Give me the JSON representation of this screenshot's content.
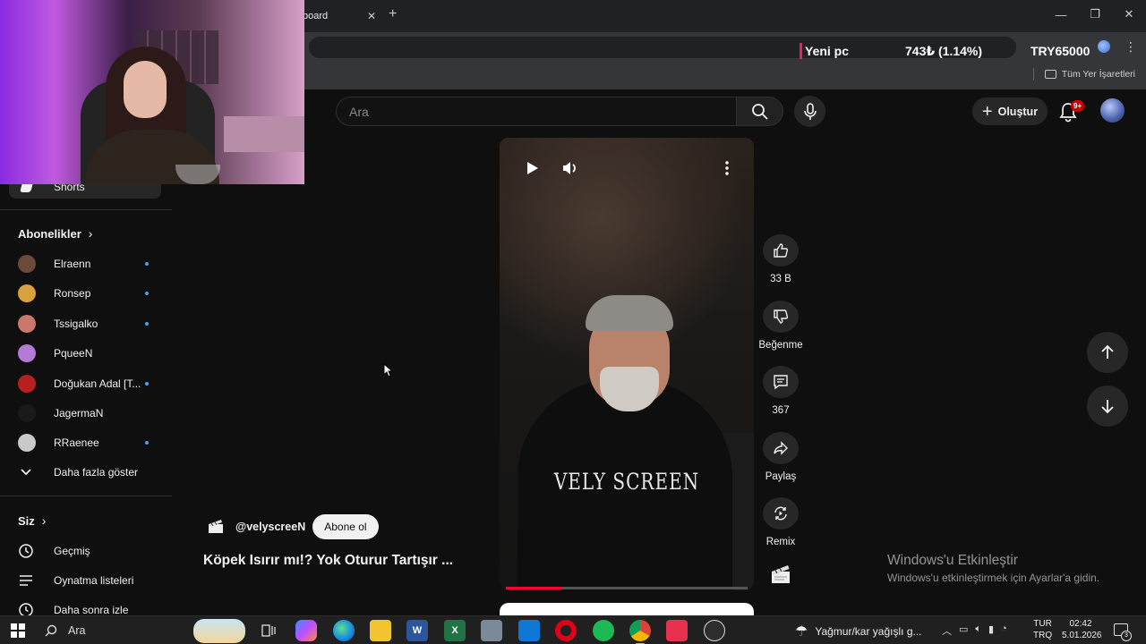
{
  "browser": {
    "tab_title": "board",
    "ticker": {
      "label": "Yeni pc",
      "change": "743₺ (1.14%)",
      "balance": "TRY65000"
    },
    "bookmarks_all": "Tüm Yer İşaretleri"
  },
  "header": {
    "search_placeholder": "Ara",
    "create_label": "Oluştur",
    "notif_badge": "9+"
  },
  "sidebar": {
    "shorts_label": "Shorts",
    "subs_title": "Abonelikler",
    "subscriptions": [
      {
        "name": "Elraenn",
        "color": "#6b4a3a",
        "new": true
      },
      {
        "name": "Ronsep",
        "color": "#d9a13b",
        "new": true
      },
      {
        "name": "Tssigalko",
        "color": "#c9786b",
        "new": true
      },
      {
        "name": "PqueeN",
        "color": "#b57ad6",
        "new": false
      },
      {
        "name": "Doğukan Adal [T...",
        "color": "#b81f1f",
        "new": true
      },
      {
        "name": "JagermaN",
        "color": "#1a1a1a",
        "new": false
      },
      {
        "name": "RRaenee",
        "color": "#c9c9c9",
        "new": true
      }
    ],
    "show_more": "Daha fazla göster",
    "you_title": "Siz",
    "you_items": [
      "Geçmiş",
      "Oynatma listeleri",
      "Daha sonra izle"
    ]
  },
  "short": {
    "channel": "@velyscreeN",
    "subscribe_label": "Abone ol",
    "title": "Köpek Isırır mı!? Yok Oturur Tartışır ...",
    "watermark": "VELY SCREEN",
    "progress": 0.23,
    "likes": "33 B",
    "dislike_label": "Beğenme",
    "comments": "367",
    "share_label": "Paylaş",
    "remix_label": "Remix"
  },
  "watermark": {
    "title": "Windows'u Etkinleştir",
    "subtitle": "Windows'u etkinleştirmek için Ayarlar'a gidin."
  },
  "taskbar": {
    "search_label": "Ara",
    "weather": "Yağmur/kar yağışlı g...",
    "lang_top": "TUR",
    "lang_bottom": "TRQ",
    "time": "02:42",
    "date": "5.01.2026",
    "notif_count": "3"
  }
}
